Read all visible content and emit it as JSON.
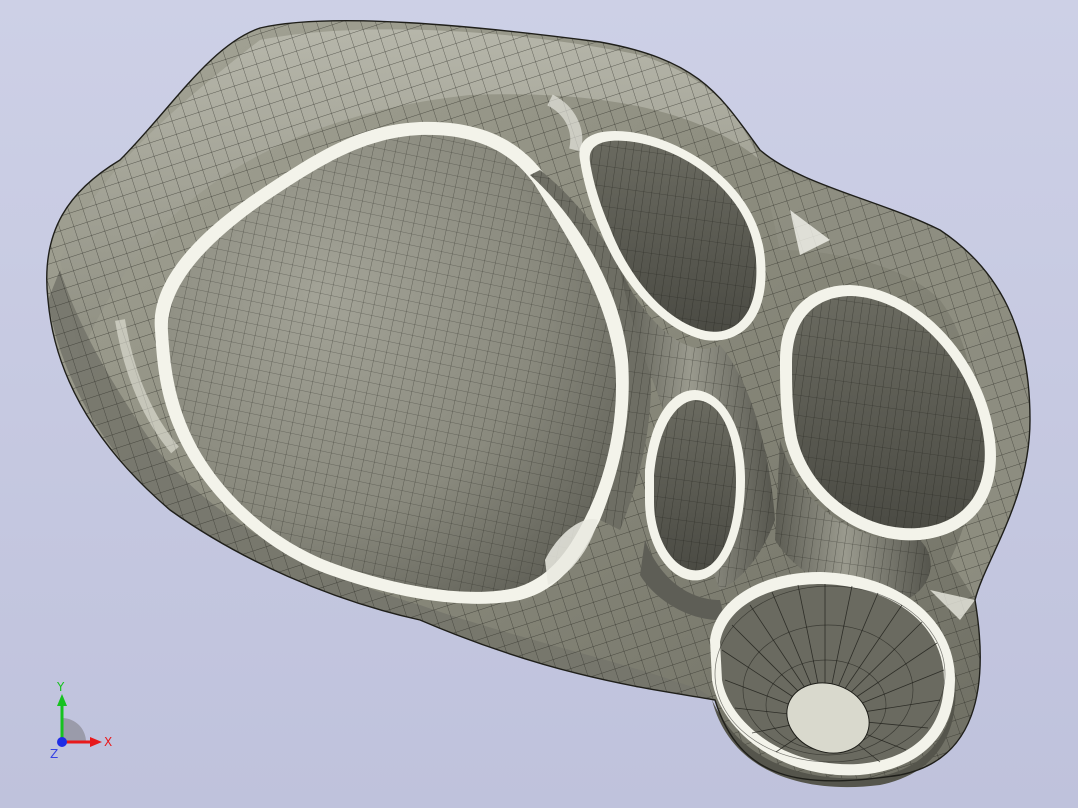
{
  "viewport": {
    "background_top": "#cdd0e6",
    "background_bottom": "#bfc2dc"
  },
  "model": {
    "surface_color": "#9a9a8c",
    "highlight_color": "#f2f2ea",
    "mesh_line_color": "#2a2a26"
  },
  "triad": {
    "x_label": "X",
    "y_label": "Y",
    "z_label": "Z",
    "x_color": "#e8191c",
    "y_color": "#16c21f",
    "z_color": "#1e2ce6"
  }
}
